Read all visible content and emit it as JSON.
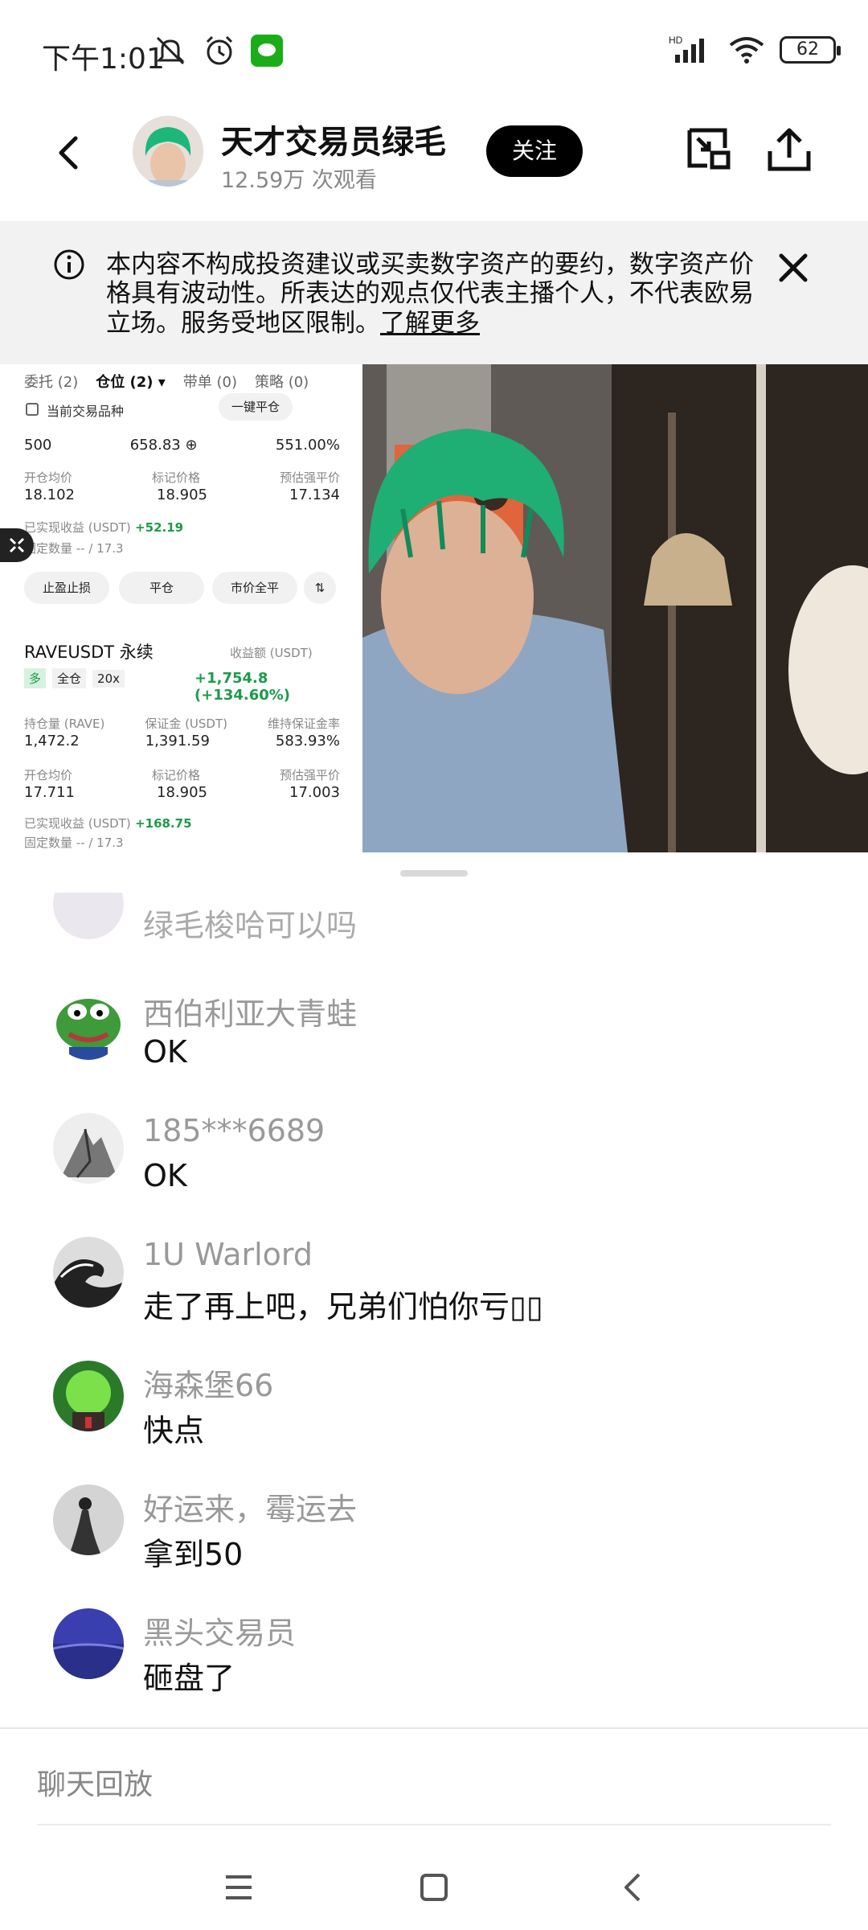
{
  "status_bar": {
    "time": "下午1:01",
    "network": "HD",
    "battery": "62"
  },
  "header": {
    "host_name": "天才交易员绿毛",
    "view_count": "12.59万 次观看",
    "follow_label": "关注"
  },
  "disclaimer": {
    "text": "本内容不构成投资建议或买卖数字资产的要约，数字资产价格具有波动性。所表达的观点仅代表主播个人，不代表欧易立场。服务受地区限制。",
    "link": "了解更多"
  },
  "trade_panel": {
    "tabs": [
      "委托 (2)",
      "仓位 (2) ▾",
      "带单 (0)",
      "策略 (0)"
    ],
    "filter_label": "当前交易品种",
    "close_all": "一键平仓",
    "pos1": {
      "row_a": [
        "500",
        "658.83 ⊕",
        "551.00%"
      ],
      "labels_b": [
        "开仓均价",
        "标记价格",
        "预估强平价"
      ],
      "row_b": [
        "18.102",
        "18.905",
        "17.134"
      ],
      "realized_label": "已实现收益 (USDT)",
      "realized_value": "+52.19",
      "fixed_qty": "固定数量 -- / 17.3"
    },
    "chips": [
      "止盈止损",
      "平仓",
      "市价全平",
      "⇅"
    ],
    "pos2": {
      "symbol": "RAVEUSDT 永续",
      "pnl_label": "收益额 (USDT)",
      "side": "多",
      "margin_mode": "全仓",
      "leverage": "20x",
      "pnl_value": "+1,754.8 (+134.60%)",
      "labels_a": [
        "持仓量 (RAVE)",
        "保证金 (USDT)",
        "维持保证金率"
      ],
      "row_a": [
        "1,472.2",
        "1,391.59",
        "583.93%"
      ],
      "labels_b": [
        "开仓均价",
        "标记价格",
        "预估强平价"
      ],
      "row_b": [
        "17.711",
        "18.905",
        "17.003"
      ],
      "realized_label": "已实现收益 (USDT)",
      "realized_value": "+168.75",
      "fixed_qty": "固定数量 -- / 17.3"
    }
  },
  "chat": {
    "messages": [
      {
        "name": "绿毛梭哈可以吗",
        "text": ""
      },
      {
        "name": "西伯利亚大青蛙",
        "text": "OK"
      },
      {
        "name": "185***6689",
        "text": "OK"
      },
      {
        "name": "1U Warlord",
        "text": "走了再上吧，兄弟们怕你亏▯▯"
      },
      {
        "name": "海森堡66",
        "text": "快点"
      },
      {
        "name": "好运来，霉运去",
        "text": "拿到50"
      },
      {
        "name": "黑头交易员",
        "text": "砸盘了"
      }
    ]
  },
  "footer": {
    "replay_label": "聊天回放"
  },
  "colors": {
    "accent_black": "#000000",
    "profit_green": "#1c9b4a",
    "banner_bg": "#f2f2f2"
  }
}
